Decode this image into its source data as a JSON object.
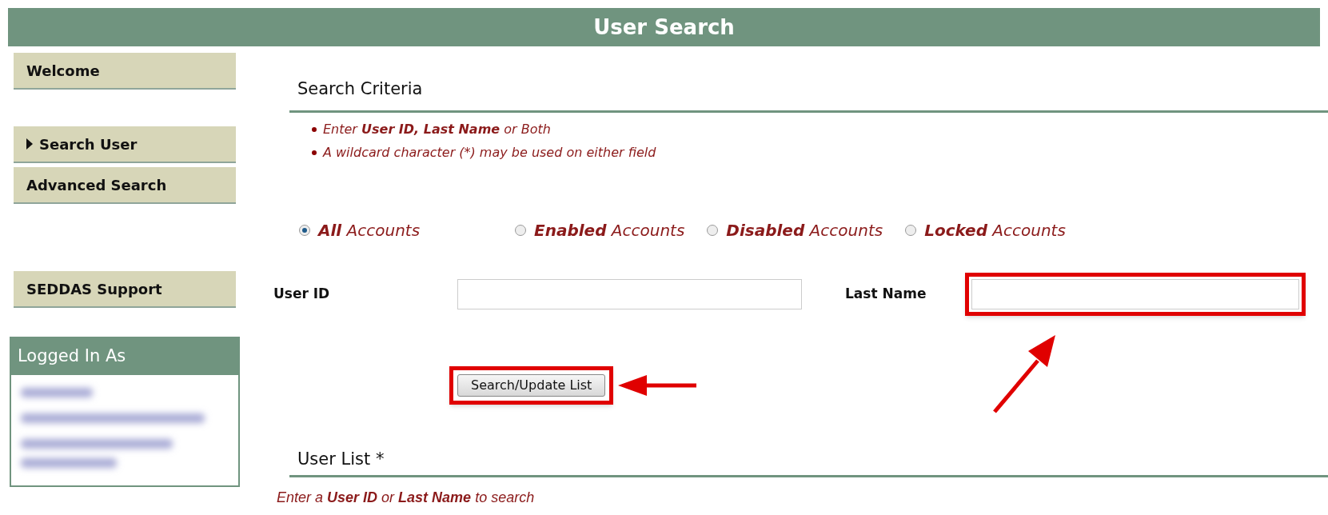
{
  "header": {
    "title": "User Search"
  },
  "sidebar": {
    "items": [
      {
        "label": "Welcome",
        "selected": false
      },
      {
        "label": "Search User",
        "selected": true
      },
      {
        "label": "Advanced Search",
        "selected": false
      },
      {
        "label": "SEDDAS Support",
        "selected": false
      }
    ],
    "logged_in": {
      "title": "Logged In As"
    }
  },
  "search_criteria": {
    "title": "Search Criteria",
    "hints": [
      "Enter **User ID, Last Name** or Both",
      "A wildcard character (*) may be used on either field"
    ],
    "account_filters": [
      {
        "label": "**All** Accounts",
        "selected": true
      },
      {
        "label": "**Enabled** Accounts",
        "selected": false
      },
      {
        "label": "**Disabled** Accounts",
        "selected": false
      },
      {
        "label": "**Locked** Accounts",
        "selected": false
      }
    ],
    "fields": [
      {
        "label": "User ID",
        "highlighted": false
      },
      {
        "label": "Last Name",
        "highlighted": true
      }
    ],
    "button": {
      "label": "Search/Update List",
      "highlighted": true
    }
  },
  "user_list": {
    "title": "User List *",
    "message": "Enter a **User ID** or **Last Name** to search"
  }
}
